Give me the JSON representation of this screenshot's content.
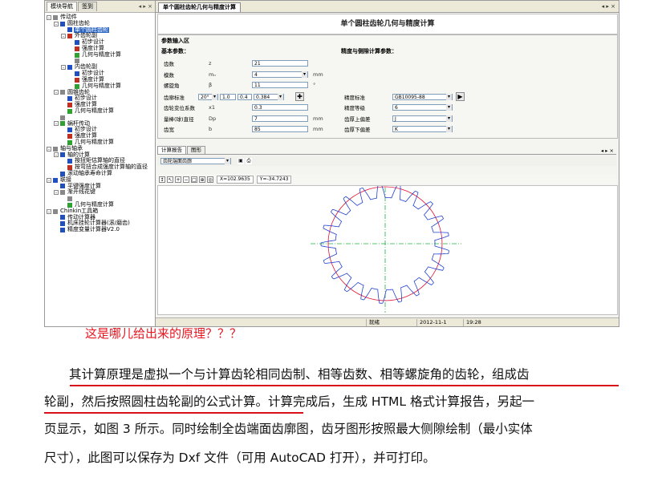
{
  "app": {
    "nav": {
      "tabs": [
        "模块导航",
        "签到"
      ],
      "arrows": "◂ ▸ ×",
      "tree": [
        {
          "label": "传动件",
          "level": 0,
          "exp": "-",
          "icon": "#888888"
        },
        {
          "label": "圆柱齿轮",
          "level": 1,
          "exp": "-",
          "icon": "#2050c0"
        },
        {
          "label": "单个圆柱齿轮",
          "level": 2,
          "exp": "",
          "icon": "#2050c0",
          "selected": true
        },
        {
          "label": "外齿轮副",
          "level": 2,
          "exp": "-",
          "icon": "#c03020"
        },
        {
          "label": "初步设计",
          "level": 3,
          "exp": "",
          "icon": "#2050c0"
        },
        {
          "label": "强度计算",
          "level": 3,
          "exp": "",
          "icon": "#c03020"
        },
        {
          "label": "几何与精度计算",
          "level": 3,
          "exp": "",
          "icon": "#30a030"
        },
        {
          "label": "",
          "level": 3,
          "exp": "",
          "icon": "#888888"
        },
        {
          "label": "内齿轮副",
          "level": 2,
          "exp": "-",
          "icon": "#2050c0"
        },
        {
          "label": "初步设计",
          "level": 3,
          "exp": "",
          "icon": "#2050c0"
        },
        {
          "label": "强度计算",
          "level": 3,
          "exp": "",
          "icon": "#c03020"
        },
        {
          "label": "几何与精度计算",
          "level": 3,
          "exp": "",
          "icon": "#30a030"
        },
        {
          "label": "圆锥齿轮",
          "level": 1,
          "exp": "-",
          "icon": "#888888"
        },
        {
          "label": "初步设计",
          "level": 2,
          "exp": "",
          "icon": "#2050c0"
        },
        {
          "label": "强度计算",
          "level": 2,
          "exp": "",
          "icon": "#c03020"
        },
        {
          "label": "几何与精度计算",
          "level": 2,
          "exp": "",
          "icon": "#30a030"
        },
        {
          "label": "",
          "level": 1,
          "exp": "",
          "icon": "#888888"
        },
        {
          "label": "蜗杆传动",
          "level": 1,
          "exp": "-",
          "icon": "#30a030"
        },
        {
          "label": "初步设计",
          "level": 2,
          "exp": "",
          "icon": "#2050c0"
        },
        {
          "label": "强度计算",
          "level": 2,
          "exp": "",
          "icon": "#c03020"
        },
        {
          "label": "几何与精度计算",
          "level": 2,
          "exp": "",
          "icon": "#30a030"
        },
        {
          "label": "轴与轴承",
          "level": 0,
          "exp": "-",
          "icon": "#888888"
        },
        {
          "label": "轴的计算",
          "level": 1,
          "exp": "-",
          "icon": "#2050c0"
        },
        {
          "label": "按扭矩估算轴的直径",
          "level": 2,
          "exp": "",
          "icon": "#2050c0"
        },
        {
          "label": "按弯扭合成强度计算轴的直径",
          "level": 2,
          "exp": "",
          "icon": "#c03020"
        },
        {
          "label": "滚动轴承寿命计算",
          "level": 1,
          "exp": "",
          "icon": "#2050c0"
        },
        {
          "label": "联接",
          "level": 0,
          "exp": "-",
          "icon": "#2050c0"
        },
        {
          "label": "平键强度计算",
          "level": 1,
          "exp": "",
          "icon": "#2050c0"
        },
        {
          "label": "渐开线花键",
          "level": 1,
          "exp": "-",
          "icon": "#888888"
        },
        {
          "label": "",
          "level": 2,
          "exp": "",
          "icon": "#888888"
        },
        {
          "label": "几何与精度计算",
          "level": 2,
          "exp": "",
          "icon": "#30a030"
        },
        {
          "label": "Chinkin工具箱",
          "level": 0,
          "exp": "-",
          "icon": "#888888"
        },
        {
          "label": "传动计算器",
          "level": 1,
          "exp": "",
          "icon": "#2050c0"
        },
        {
          "label": "机床挂轮计算器(滚/磨齿)",
          "level": 1,
          "exp": "",
          "icon": "#2050c0"
        },
        {
          "label": "精度变量计算器V2.0",
          "level": 1,
          "exp": "",
          "icon": "#2050c0"
        }
      ]
    },
    "doc_tab": "单个圆柱齿轮几何与精度计算",
    "doc_ctrl": "◂ ▸ ×",
    "panel_title": "单个圆柱齿轮几何与精度计算",
    "params_title": "参数输入区",
    "basic_title": "基本参数：",
    "tolerance_title": "精度与侧隙计算参数：",
    "basic_fields": [
      {
        "label": "齿数",
        "sym": "z",
        "value": "21",
        "type": "input",
        "unit": ""
      },
      {
        "label": "模数",
        "sym": "mₙ",
        "value": "4",
        "type": "select",
        "unit": "mm"
      },
      {
        "label": "螺旋角",
        "sym": "β",
        "value": "11",
        "type": "input",
        "unit": "°"
      },
      {
        "label": "齿廓标准",
        "sym": "",
        "value": "",
        "type": "profile",
        "unit": ""
      },
      {
        "label": "齿轮变位系数",
        "sym": "x1",
        "value": "0.3",
        "type": "input",
        "unit": ""
      },
      {
        "label": "量棒(球)直径",
        "sym": "Dp",
        "value": "7",
        "type": "input",
        "unit": "mm"
      },
      {
        "label": "齿宽",
        "sym": "b",
        "value": "85",
        "type": "input",
        "unit": "mm"
      }
    ],
    "profile_values": [
      "20°",
      "1.0",
      "0.4",
      "0.384"
    ],
    "tolerance_fields": [
      {
        "label": "精度标准",
        "value": "GB10095-88"
      },
      {
        "label": "精度等级",
        "value": "6"
      },
      {
        "label": "齿厚上偏差",
        "value": "J"
      },
      {
        "label": "齿厚下偏差",
        "value": "K"
      }
    ],
    "go_icon": "✚",
    "report_tabs": [
      "计算报告",
      "图形"
    ],
    "report_ctrl": "◂ ▸ ×",
    "view_select": "齿轮端面齿廓",
    "coord_x": "X=102.9635",
    "coord_y": "Y=-34.7243",
    "status": {
      "cell1": "就绪",
      "date": "2012-11-1",
      "time": "19:28"
    }
  },
  "drawing": {
    "teeth": 21,
    "colors": {
      "profile": "#2040d0",
      "pitch": "#e01030",
      "center": "#20b040"
    }
  },
  "annotation": "这是哪儿给出来的原理？？？",
  "paragraph": {
    "line1": "其计算原理是虚拟一个与计算齿轮相同齿制、相等齿数、相等螺旋角的齿轮，组成齿",
    "line2": "轮副，然后按照圆柱齿轮副的公式计算。计算完成后，生成 HTML 格式计算报告，另起一",
    "line3": "页显示，如图 3 所示。同时绘制全齿端面齿廓图，齿牙图形按照最大侧隙绘制（最小实体",
    "line4": "尺寸），此图可以保存为 Dxf 文件（可用 AutoCAD 打开），并可打印。"
  }
}
